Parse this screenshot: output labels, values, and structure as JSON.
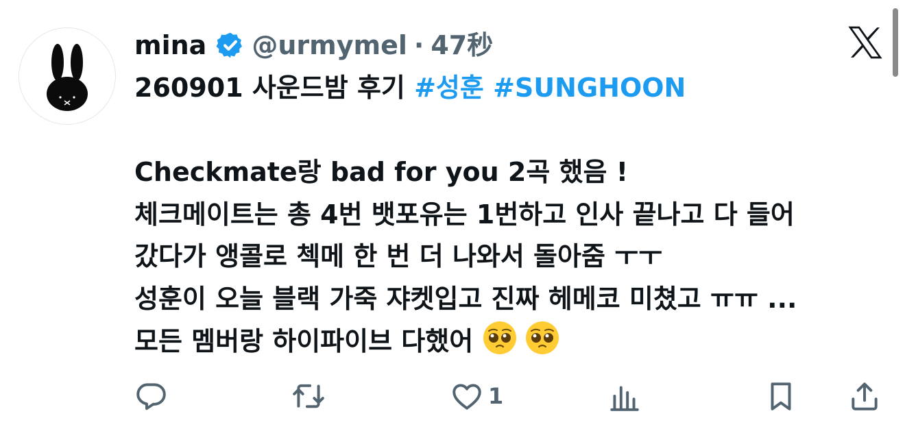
{
  "author": {
    "display_name": "mina",
    "handle": "@urmymel",
    "separator": "·",
    "time": "47秒",
    "verified": true
  },
  "post": {
    "line1": {
      "text": "260901 사운드밤 후기 ",
      "hashtags": [
        "#성훈",
        "#SUNGHOON"
      ]
    },
    "line2": "",
    "line3": "Checkmate랑 bad for you 2곡 했음 !",
    "line4": "체크메이트는 총 4번 뱃포유는 1번하고 인사 끝나고 다 들어",
    "line5": "갔다가 앵콜로 첵메 한 번 더 나와서 돌아줌 ㅜㅜ",
    "line6": "성훈이 오늘 블랙 가죽 쟈켓입고 진짜 헤메코 미쳤고 ㅠㅠ ...",
    "line7": "모든 멤버랑 하이파이브 다했어",
    "emojis": [
      "pleading-face",
      "pleading-face"
    ]
  },
  "actions": {
    "reply_count": "",
    "repost_count": "",
    "like_count": "1",
    "views_count": ""
  },
  "icons": {
    "logo": "x-logo",
    "reply": "reply-icon",
    "repost": "repost-icon",
    "like": "heart-icon",
    "views": "views-icon",
    "bookmark": "bookmark-icon",
    "share": "share-icon"
  },
  "colors": {
    "text": "#0f1419",
    "secondary": "#536471",
    "accent": "#1d9bf0"
  }
}
